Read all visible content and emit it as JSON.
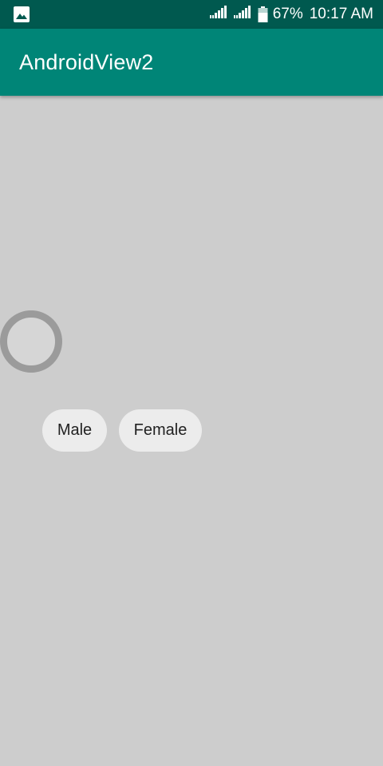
{
  "status_bar": {
    "notification_icon": "image-icon",
    "battery_percent": "67%",
    "time": "10:17 AM"
  },
  "app_bar": {
    "title": "AndroidView2"
  },
  "content": {
    "progress_indicator": "progress-ring-icon",
    "chips": [
      {
        "label": "Male"
      },
      {
        "label": "Female"
      }
    ]
  },
  "colors": {
    "status_bar": "#00594f",
    "app_bar": "#008577",
    "background": "#cdcdcd",
    "chip": "#ececec"
  }
}
